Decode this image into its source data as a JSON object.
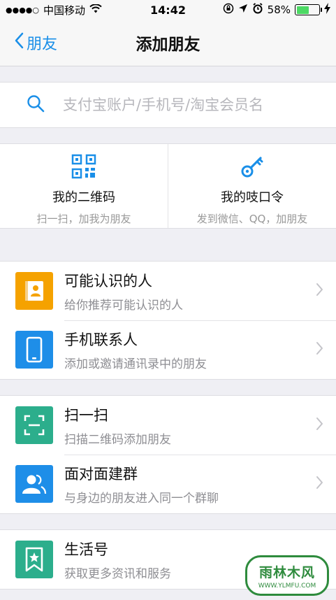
{
  "status_bar": {
    "carrier": "中国移动",
    "time": "14:42",
    "battery_percent": 58,
    "battery_label": "58%"
  },
  "nav": {
    "back_label": "朋友",
    "title": "添加朋友"
  },
  "search": {
    "placeholder": "支付宝账户/手机号/淘宝会员名",
    "value": ""
  },
  "quick_actions": [
    {
      "title": "我的二维码",
      "subtitle": "扫一扫，加我为朋友",
      "icon": "qr-code-icon"
    },
    {
      "title": "我的吱口令",
      "subtitle": "发到微信、QQ，加朋友",
      "icon": "key-icon"
    }
  ],
  "groups": [
    {
      "items": [
        {
          "title": "可能认识的人",
          "subtitle": "给你推荐可能认识的人",
          "icon": "contact-book-icon",
          "color": "#f5a200"
        },
        {
          "title": "手机联系人",
          "subtitle": "添加或邀请通讯录中的朋友",
          "icon": "phone-icon",
          "color": "#1e8ee8"
        }
      ]
    },
    {
      "items": [
        {
          "title": "扫一扫",
          "subtitle": "扫描二维码添加朋友",
          "icon": "scan-icon",
          "color": "#2cae8c"
        },
        {
          "title": "面对面建群",
          "subtitle": "与身边的朋友进入同一个群聊",
          "icon": "group-icon",
          "color": "#1e8ee8"
        }
      ]
    },
    {
      "items": [
        {
          "title": "生活号",
          "subtitle": "获取更多资讯和服务",
          "icon": "bookmark-star-icon",
          "color": "#2cae8c"
        }
      ]
    }
  ],
  "watermark": {
    "brand": "雨林木风",
    "url": "WWW.YLMFU.COM"
  },
  "colors": {
    "accent": "#1a8fe8",
    "background": "#efeff4",
    "battery": "#4cd964"
  }
}
